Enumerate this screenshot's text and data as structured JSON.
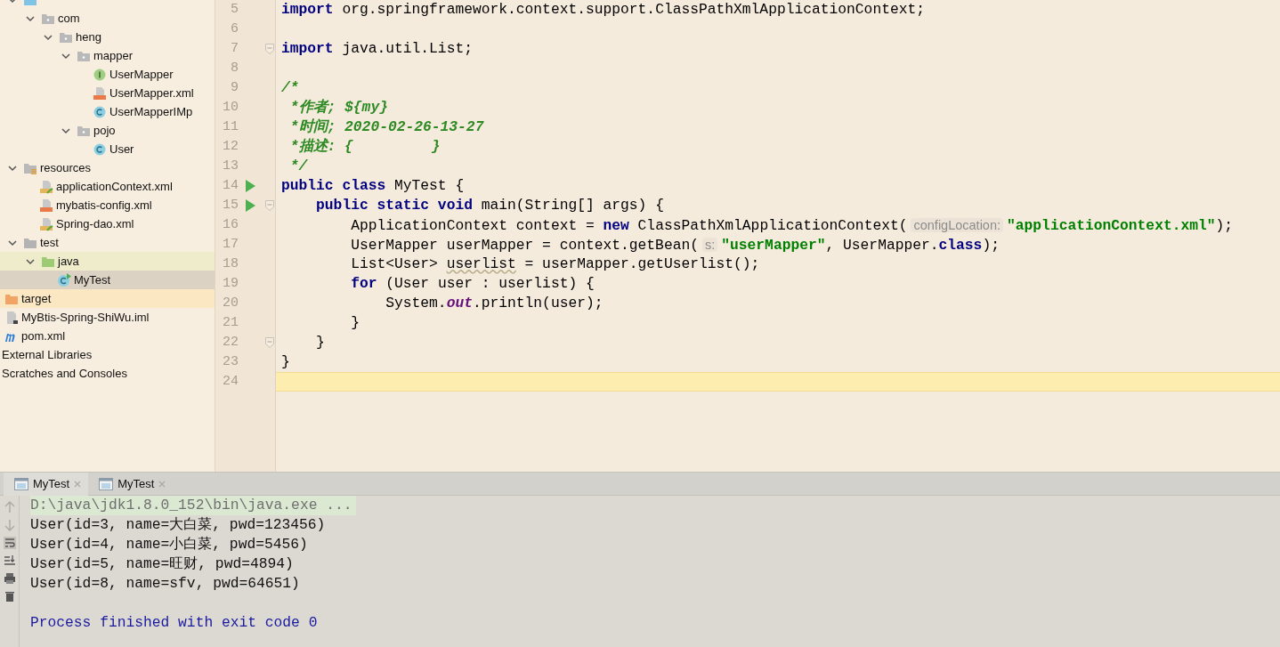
{
  "project_tree": [
    {
      "kind": "source-folder",
      "expanded": true,
      "selected": false,
      "children": [
        {
          "label": "com",
          "kind": "package",
          "expanded": true,
          "selected": false,
          "children": [
            {
              "label": "heng",
              "kind": "package",
              "expanded": true,
              "selected": false,
              "children": [
                {
                  "label": "mapper",
                  "kind": "package",
                  "expanded": true,
                  "selected": false,
                  "children": [
                    {
                      "label": "UserMapper",
                      "kind": "interface",
                      "selected": false
                    },
                    {
                      "label": "UserMapper.xml",
                      "kind": "xml",
                      "selected": false
                    },
                    {
                      "label": "UserMapperIMp",
                      "kind": "class",
                      "selected": false
                    }
                  ]
                },
                {
                  "label": "pojo",
                  "kind": "package",
                  "expanded": true,
                  "selected": false,
                  "children": [
                    {
                      "label": "User",
                      "kind": "class",
                      "selected": false
                    }
                  ]
                }
              ]
            }
          ]
        }
      ]
    },
    {
      "label": "resources",
      "kind": "resources-folder",
      "expanded": true,
      "selected": false,
      "children": [
        {
          "label": "applicationContext.xml",
          "kind": "spring-xml",
          "selected": false
        },
        {
          "label": "mybatis-config.xml",
          "kind": "xml",
          "selected": false
        },
        {
          "label": "Spring-dao.xml",
          "kind": "spring-xml",
          "selected": false
        }
      ]
    },
    {
      "label": "test",
      "kind": "folder",
      "expanded": true,
      "selected": false,
      "children": [
        {
          "label": "java",
          "kind": "test-folder",
          "expanded": true,
          "selected": false,
          "children": [
            {
              "label": "MyTest",
              "kind": "test-class",
              "selected": true
            }
          ]
        }
      ]
    },
    {
      "label": "target",
      "kind": "excluded-folder",
      "selected": false
    },
    {
      "label": "MyBtis-Spring-ShiWu.iml",
      "kind": "iml",
      "selected": false
    },
    {
      "label": "pom.xml",
      "kind": "maven",
      "selected": false
    },
    {
      "label": "External Libraries",
      "kind": "plain",
      "selected": false
    },
    {
      "label": "Scratches and Consoles",
      "kind": "plain",
      "selected": false
    }
  ],
  "editor": {
    "lines": [
      {
        "number": "5",
        "run": false,
        "fold": false,
        "current": false,
        "tokens": [
          {
            "kind": "kw",
            "text": "import"
          },
          {
            "kind": "plain",
            "text": " org.springframework.context.support.ClassPathXmlApplicationContext;"
          }
        ]
      },
      {
        "number": "6",
        "run": false,
        "fold": false,
        "current": false
      },
      {
        "number": "7",
        "run": false,
        "fold": true,
        "current": false,
        "tokens": [
          {
            "kind": "kw",
            "text": "import"
          },
          {
            "kind": "plain",
            "text": " java.util.List;"
          }
        ]
      },
      {
        "number": "8",
        "run": false,
        "fold": false,
        "current": false
      },
      {
        "number": "9",
        "run": false,
        "fold": false,
        "current": false,
        "tokens": [
          {
            "kind": "comment",
            "text": "/*"
          }
        ]
      },
      {
        "number": "10",
        "run": false,
        "fold": false,
        "current": false,
        "tokens": [
          {
            "kind": "comment",
            "text": " *作者; ${my}"
          }
        ]
      },
      {
        "number": "11",
        "run": false,
        "fold": false,
        "current": false,
        "tokens": [
          {
            "kind": "comment",
            "text": " *时间; 2020-02-26-13-27"
          }
        ]
      },
      {
        "number": "12",
        "run": false,
        "fold": false,
        "current": false,
        "tokens": [
          {
            "kind": "comment",
            "text": " *描述: {         }"
          }
        ]
      },
      {
        "number": "13",
        "run": false,
        "fold": false,
        "current": false,
        "tokens": [
          {
            "kind": "comment",
            "text": " */"
          }
        ]
      },
      {
        "number": "14",
        "run": true,
        "fold": false,
        "current": false,
        "tokens": [
          {
            "kind": "kw",
            "text": "public class"
          },
          {
            "kind": "plain",
            "text": " MyTest {"
          }
        ]
      },
      {
        "number": "15",
        "run": true,
        "fold": true,
        "current": false,
        "tokens": [
          {
            "kind": "kw",
            "text": "    public static void"
          },
          {
            "kind": "plain",
            "text": " main(String[] args) {"
          }
        ]
      },
      {
        "number": "16",
        "run": false,
        "fold": false,
        "current": false,
        "tokens": [
          {
            "kind": "plain",
            "text": "        ApplicationContext context = "
          },
          {
            "kind": "kw",
            "text": "new"
          },
          {
            "kind": "plain",
            "text": " ClassPathXmlApplicationContext("
          },
          {
            "kind": "hint",
            "text": "configLocation:"
          },
          {
            "kind": "str",
            "text": "\"applicationContext.xml\""
          },
          {
            "kind": "plain",
            "text": ");"
          }
        ]
      },
      {
        "number": "17",
        "run": false,
        "fold": false,
        "current": false,
        "tokens": [
          {
            "kind": "plain",
            "text": "        UserMapper userMapper = context.getBean("
          },
          {
            "kind": "hint",
            "text": "s:"
          },
          {
            "kind": "str",
            "text": "\"userMapper\""
          },
          {
            "kind": "plain",
            "text": ", UserMapper."
          },
          {
            "kind": "kw",
            "text": "class"
          },
          {
            "kind": "plain",
            "text": ");"
          }
        ]
      },
      {
        "number": "18",
        "run": false,
        "fold": false,
        "current": false,
        "tokens": [
          {
            "kind": "plain",
            "text": "        List<User> "
          },
          {
            "kind": "warn",
            "text": "userlist"
          },
          {
            "kind": "plain",
            "text": " = userMapper.getUserlist();"
          }
        ]
      },
      {
        "number": "19",
        "run": false,
        "fold": false,
        "current": false,
        "tokens": [
          {
            "kind": "kw",
            "text": "        for"
          },
          {
            "kind": "plain",
            "text": " (User user : userlist) {"
          }
        ]
      },
      {
        "number": "20",
        "run": false,
        "fold": false,
        "current": false,
        "tokens": [
          {
            "kind": "plain",
            "text": "            System."
          },
          {
            "kind": "field",
            "text": "out"
          },
          {
            "kind": "plain",
            "text": ".println(user);"
          }
        ]
      },
      {
        "number": "21",
        "run": false,
        "fold": false,
        "current": false,
        "tokens": [
          {
            "kind": "plain",
            "text": "        }"
          }
        ]
      },
      {
        "number": "22",
        "run": false,
        "fold": true,
        "current": false,
        "tokens": [
          {
            "kind": "plain",
            "text": "    }"
          }
        ]
      },
      {
        "number": "23",
        "run": false,
        "fold": false,
        "current": false,
        "tokens": [
          {
            "kind": "plain",
            "text": "}"
          }
        ]
      },
      {
        "number": "24",
        "run": false,
        "fold": false,
        "current": true
      }
    ]
  },
  "run_panel": {
    "tabs": [
      {
        "label": "MyTest",
        "selected": true
      },
      {
        "label": "MyTest",
        "selected": false
      }
    ],
    "output": [
      {
        "kind": "command",
        "text": "D:\\java\\jdk1.8.0_152\\bin\\java.exe ..."
      },
      {
        "kind": "stdout",
        "text": "User(id=3, name=大白菜, pwd=123456)"
      },
      {
        "kind": "stdout",
        "text": "User(id=4, name=小白菜, pwd=5456)"
      },
      {
        "kind": "stdout",
        "text": "User(id=5, name=旺财, pwd=4894)"
      },
      {
        "kind": "stdout",
        "text": "User(id=8, name=sfv, pwd=64651)"
      },
      {
        "kind": "blank"
      },
      {
        "kind": "system",
        "text": "Process finished with exit code 0"
      }
    ]
  }
}
